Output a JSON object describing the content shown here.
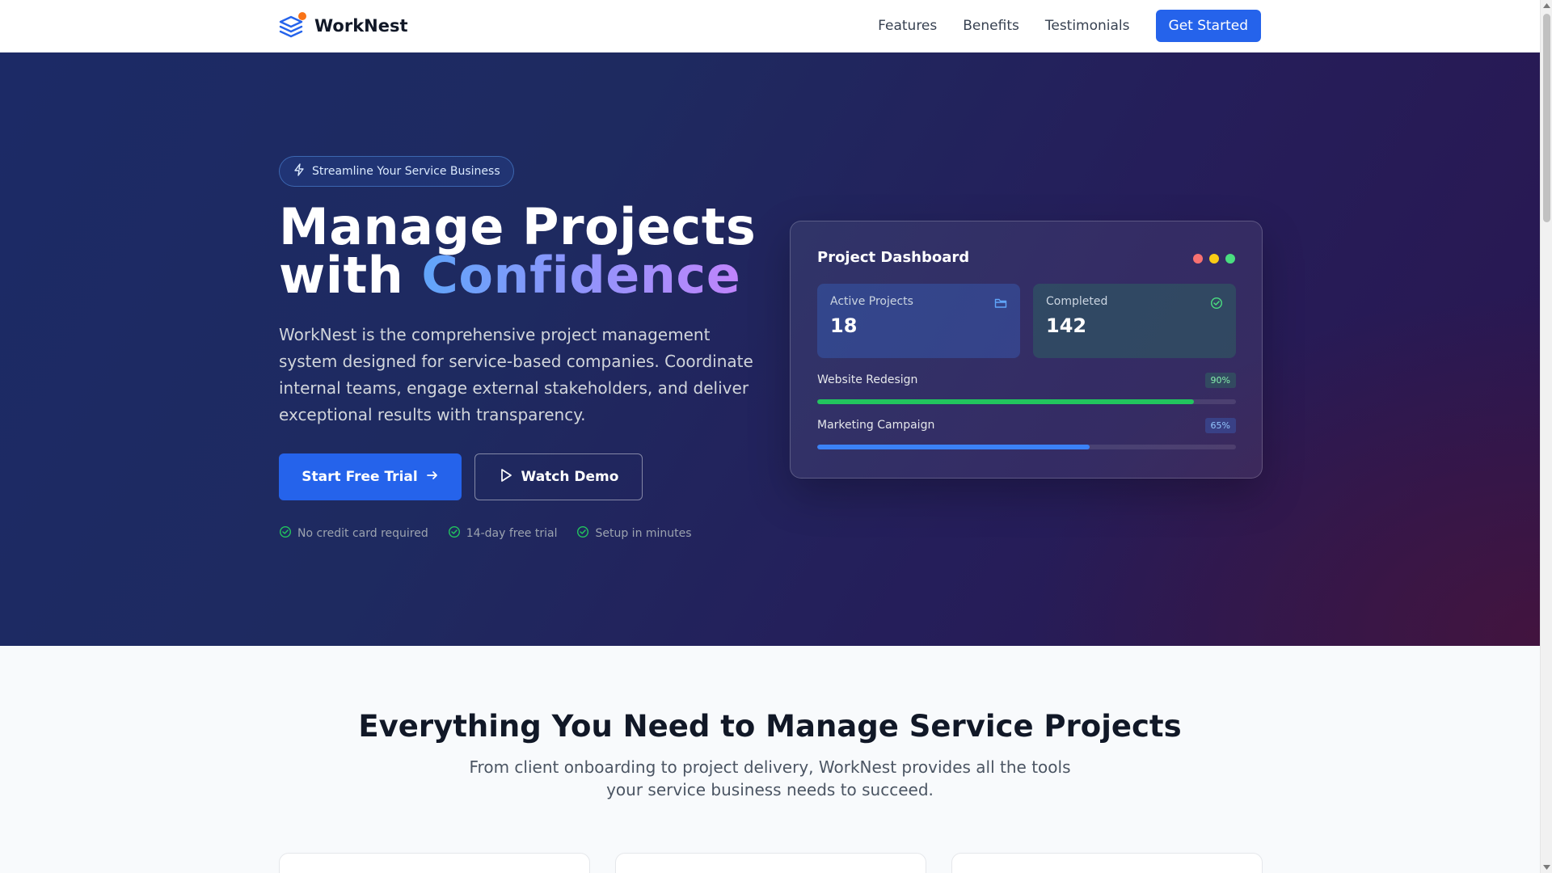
{
  "nav": {
    "brand": "WorkNest",
    "links": [
      "Features",
      "Benefits",
      "Testimonials"
    ],
    "cta": "Get Started"
  },
  "hero": {
    "badge": "Streamline Your Service Business",
    "title_line1": "Manage Projects",
    "title_line2_plain": "with",
    "title_line2_accent": "Confidence",
    "description": "WorkNest is the comprehensive project management system designed for service-based companies. Coordinate internal teams, engage external stakeholders, and deliver exceptional results with transparency.",
    "primary_button": "Start Free Trial",
    "secondary_button": "Watch Demo",
    "perks": [
      "No credit card required",
      "14-day free trial",
      "Setup in minutes"
    ]
  },
  "dashboard": {
    "title": "Project Dashboard",
    "window_dot_colors": [
      "#f87171",
      "#facc15",
      "#4ade80"
    ],
    "stats": [
      {
        "label": "Active Projects",
        "value": "18",
        "icon": "folder-icon"
      },
      {
        "label": "Completed",
        "value": "142",
        "icon": "check-circle-icon"
      }
    ],
    "progress": [
      {
        "name": "Website Redesign",
        "percent_label": "90%",
        "value": 0.9,
        "color": "#22c55e"
      },
      {
        "name": "Marketing Campaign",
        "percent_label": "65%",
        "value": 0.65,
        "color": "#3b82f6"
      }
    ]
  },
  "features": {
    "title": "Everything You Need to Manage Service Projects",
    "subtitle": "From client onboarding to project delivery, WorkNest provides all the tools your service business needs to succeed."
  },
  "colors": {
    "accent": "#2563eb",
    "logo_dot": "#f97316",
    "success": "#22c55e"
  }
}
